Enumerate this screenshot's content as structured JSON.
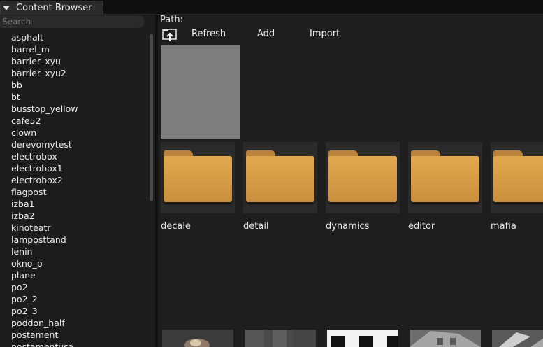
{
  "window": {
    "title": "Content Browser"
  },
  "search": {
    "placeholder": "Search",
    "value": ""
  },
  "sidebar": {
    "items": [
      "asphalt",
      "barrel_m",
      "barrier_xyu",
      "barrier_xyu2",
      "bb",
      "bt",
      "busstop_yellow",
      "cafe52",
      "clown",
      "derevomytest",
      "electrobox",
      "electrobox1",
      "electrobox2",
      "flagpost",
      "izba1",
      "izba2",
      "kinoteatr",
      "lamposttand",
      "lenin",
      "okno_p",
      "plane",
      "po2",
      "po2_2",
      "po2_3",
      "poddon_half",
      "postament",
      "postamentusa"
    ]
  },
  "main": {
    "path_label": "Path:",
    "toolbar": {
      "refresh": "Refresh",
      "add": "Add",
      "import": "Import"
    },
    "folders": [
      "decale",
      "detail",
      "dynamics",
      "editor",
      "mafia"
    ],
    "colors": {
      "folder": "#d9a04a",
      "preview": "#7d7d7d",
      "tile_bg": "#2a2a2a"
    }
  }
}
